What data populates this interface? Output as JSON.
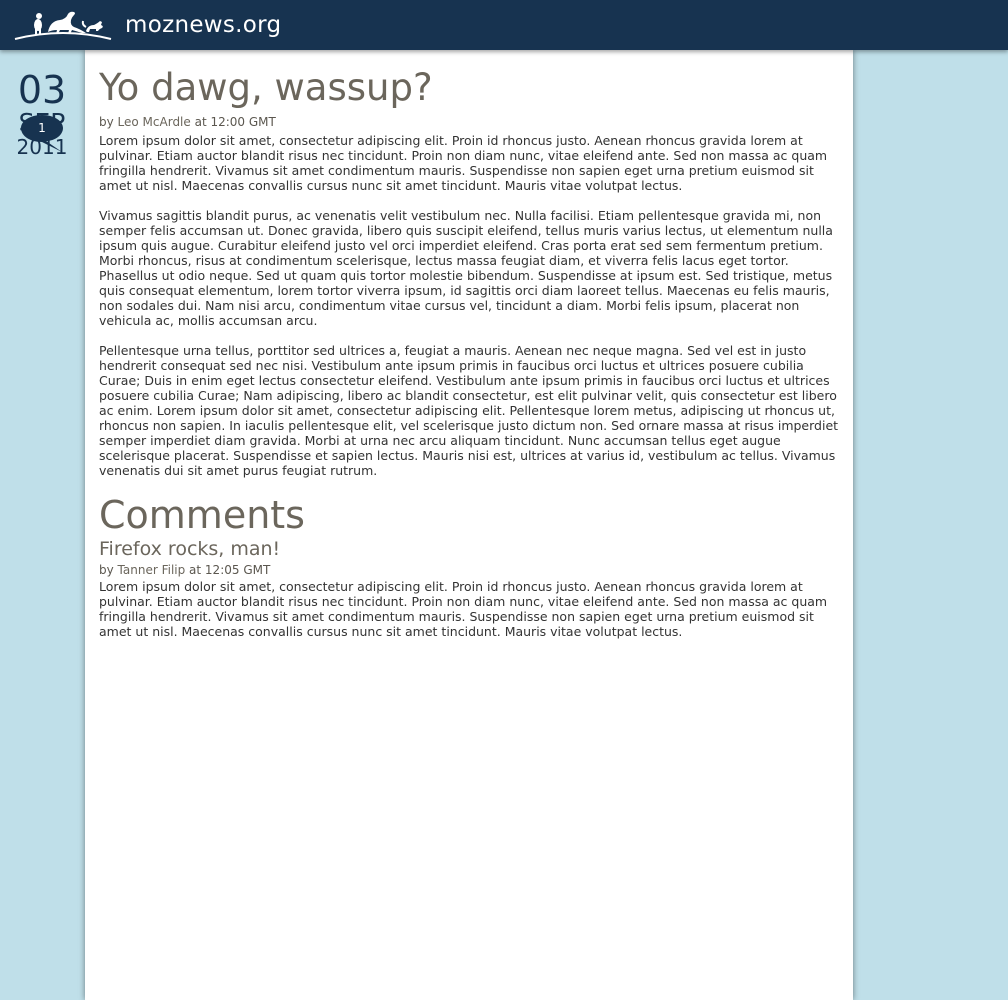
{
  "site": {
    "name": "moznews.org",
    "colors": {
      "topbar": "#173350",
      "page_bg": "#bfdfe9",
      "heading": "#6b665c",
      "text": "#333333"
    }
  },
  "date": {
    "day": "03",
    "month": "SEP",
    "year": "2011",
    "comment_count": "1"
  },
  "post": {
    "title": "Yo dawg, wassup?",
    "byline_prefix": "by ",
    "author": "Leo McArdle",
    "byline_suffix": " at 12:00 GMT",
    "paragraphs": [
      "Lorem ipsum dolor sit amet, consectetur adipiscing elit. Proin id rhoncus justo. Aenean rhoncus gravida lorem at pulvinar. Etiam auctor blandit risus nec tincidunt. Proin non diam nunc, vitae eleifend ante. Sed non massa ac quam fringilla hendrerit. Vivamus sit amet condimentum mauris. Suspendisse non sapien eget urna pretium euismod sit amet ut nisl. Maecenas convallis cursus nunc sit amet tincidunt. Mauris vitae volutpat lectus.",
      "Vivamus sagittis blandit purus, ac venenatis velit vestibulum nec. Nulla facilisi. Etiam pellentesque gravida mi, non semper felis accumsan ut. Donec gravida, libero quis suscipit eleifend, tellus muris varius lectus, ut elementum nulla ipsum quis augue. Curabitur eleifend justo vel orci imperdiet eleifend. Cras porta erat sed sem fermentum pretium. Morbi rhoncus, risus at condimentum scelerisque, lectus massa feugiat diam, et viverra felis lacus eget tortor. Phasellus ut odio neque. Sed ut quam quis tortor molestie bibendum. Suspendisse at ipsum est. Sed tristique, metus quis consequat elementum, lorem tortor viverra ipsum, id sagittis orci diam laoreet tellus. Maecenas eu felis mauris, non sodales dui. Nam nisi arcu, condimentum vitae cursus vel, tincidunt a diam. Morbi felis ipsum, placerat non vehicula ac, mollis accumsan arcu.",
      "Pellentesque urna tellus, porttitor sed ultrices a, feugiat a mauris. Aenean nec neque magna. Sed vel est in justo hendrerit consequat sed nec nisi. Vestibulum ante ipsum primis in faucibus orci luctus et ultrices posuere cubilia Curae; Duis in enim eget lectus consectetur eleifend. Vestibulum ante ipsum primis in faucibus orci luctus et ultrices posuere cubilia Curae; Nam adipiscing, libero ac blandit consectetur, est elit pulvinar velit, quis consectetur est libero ac enim. Lorem ipsum dolor sit amet, consectetur adipiscing elit. Pellentesque lorem metus, adipiscing ut rhoncus ut, rhoncus non sapien. In iaculis pellentesque elit, vel scelerisque justo dictum non. Sed ornare massa at risus imperdiet semper imperdiet diam gravida. Morbi at urna nec arcu aliquam tincidunt. Nunc accumsan tellus eget augue scelerisque placerat. Suspendisse et sapien lectus. Mauris nisi est, ultrices at varius id, vestibulum ac tellus. Vivamus venenatis dui sit amet purus feugiat rutrum."
    ]
  },
  "comments": {
    "heading": "Comments",
    "items": [
      {
        "title": "Firefox rocks, man!",
        "byline_prefix": "by ",
        "author": "Tanner Filip",
        "byline_suffix": " at 12:05 GMT",
        "body": "Lorem ipsum dolor sit amet, consectetur adipiscing elit. Proin id rhoncus justo. Aenean rhoncus gravida lorem at pulvinar. Etiam auctor blandit risus nec tincidunt. Proin non diam nunc, vitae eleifend ante. Sed non massa ac quam fringilla hendrerit. Vivamus sit amet condimentum mauris. Suspendisse non sapien eget urna pretium euismod sit amet ut nisl. Maecenas convallis cursus nunc sit amet tincidunt. Mauris vitae volutpat lectus."
      }
    ]
  },
  "icons": {
    "logo": "dinosaur-logo-icon",
    "comment": "speech-bubble-icon"
  }
}
